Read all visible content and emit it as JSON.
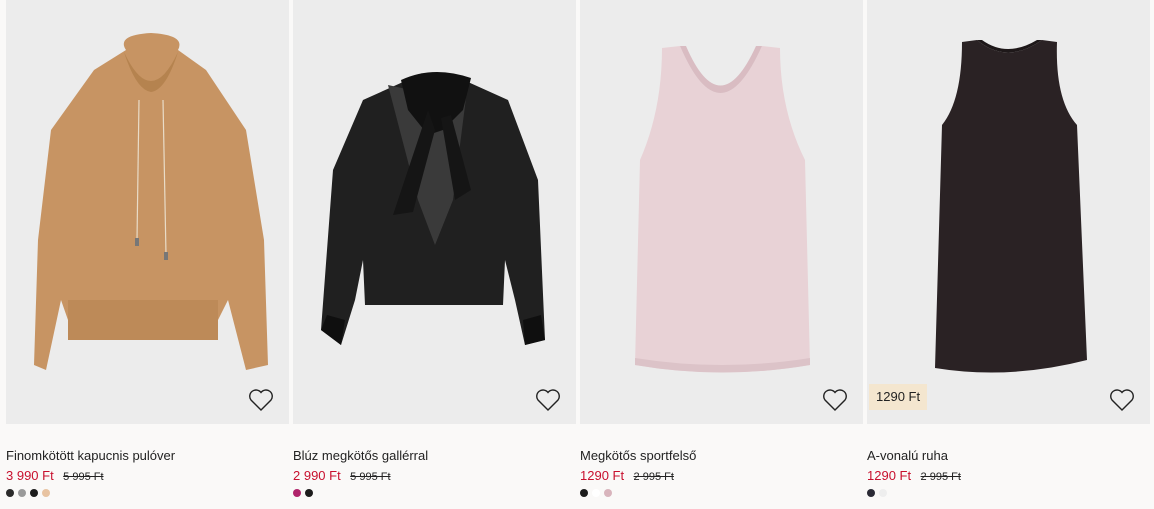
{
  "products": [
    {
      "name": "Finomkötött kapucnis pulóver",
      "price": "3 990 Ft",
      "old_price": "5 995 Ft",
      "badge": "",
      "swatches": [
        "#2b2b2b",
        "#9a9a9a",
        "#1c1c1c",
        "#e8c3a1"
      ],
      "favorite_icon": "heart-outline-icon"
    },
    {
      "name": "Blúz megkötős gallérral",
      "price": "2 990 Ft",
      "old_price": "5 995 Ft",
      "badge": "",
      "swatches": [
        "#b0246b",
        "#1c1c1c"
      ],
      "favorite_icon": "heart-outline-icon"
    },
    {
      "name": "Megkötős sportfelső",
      "price": "1290 Ft",
      "old_price": "2 995 Ft",
      "badge": "",
      "swatches": [
        "#1c1c1c",
        "#ffffff",
        "#d8b4bc"
      ],
      "favorite_icon": "heart-outline-icon"
    },
    {
      "name": "A-vonalú ruha",
      "price": "1290 Ft",
      "old_price": "2 995 Ft",
      "badge": "1290 Ft",
      "swatches": [
        "#2a2a35",
        "#eeeeee"
      ],
      "favorite_icon": "heart-outline-icon"
    }
  ],
  "colors": {
    "sale_price": "#c8102e",
    "badge_bg": "#f4e6cf",
    "image_bg": "#ececec",
    "page_bg": "#faf9f8"
  }
}
